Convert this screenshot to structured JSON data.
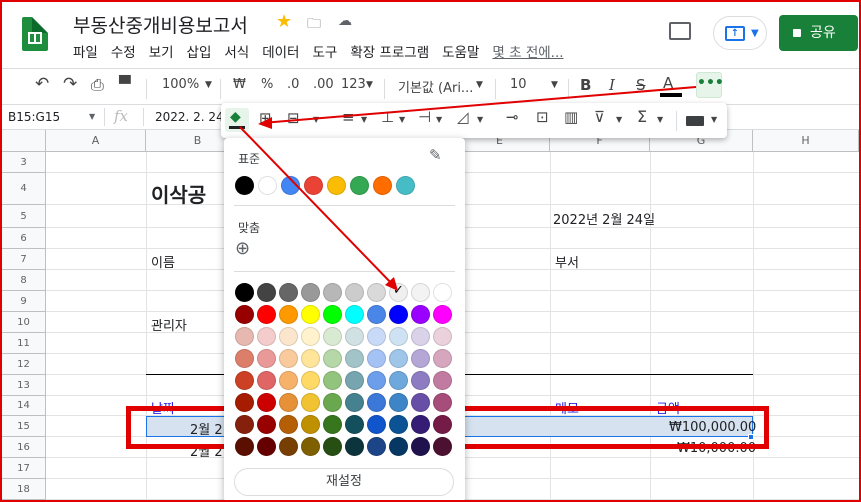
{
  "app": {
    "title": "부동산중개비용보고서",
    "share_label": "공유"
  },
  "menu": [
    "파일",
    "수정",
    "보기",
    "삽입",
    "서식",
    "데이터",
    "도구",
    "확장 프로그램",
    "도움말"
  ],
  "last_edit": "몇 초 전에...",
  "toolbar": {
    "zoom": "100%",
    "currency": "₩",
    "percent": "%",
    "dec_less": ".0",
    "dec_more": ".00",
    "format": "123",
    "font": "기본값 (Ari...",
    "font_size": "10",
    "bold": "B",
    "italic": "I",
    "strike": "S",
    "text_color": "A",
    "more": "•••"
  },
  "formula": {
    "range": "B15:G15",
    "fx": "fx",
    "value": "2022. 2. 24"
  },
  "columns": [
    "A",
    "B",
    "C",
    "D",
    "E",
    "F",
    "G",
    "H"
  ],
  "rows": [
    "3",
    "4",
    "5",
    "6",
    "7",
    "8",
    "9",
    "10",
    "11",
    "12",
    "13",
    "14",
    "15",
    "16",
    "17",
    "18"
  ],
  "cells": {
    "b4": "이삭공",
    "f5": "2022년 2월 24일",
    "b7": "이름",
    "f7": "부서",
    "b10": "관리자",
    "b14": "날짜",
    "f14": "메모",
    "g14": "금액",
    "b15": "2월 2",
    "g15": "₩100,000.00",
    "b16": "2월 2",
    "g16": "₩10,000.00"
  },
  "palette": {
    "standard_label": "표준",
    "custom_label": "맞춤",
    "reset_label": "재설정",
    "standard": [
      "#000000",
      "#ffffff",
      "#4285f4",
      "#ea4335",
      "#fbbc04",
      "#34a853",
      "#ff6d01",
      "#46bdc6"
    ],
    "grid": [
      [
        "#000000",
        "#434343",
        "#666666",
        "#999999",
        "#b7b7b7",
        "#cccccc",
        "#d9d9d9",
        "#efefef",
        "#f3f3f3",
        "#ffffff"
      ],
      [
        "#980000",
        "#ff0000",
        "#ff9900",
        "#ffff00",
        "#00ff00",
        "#00ffff",
        "#4a86e8",
        "#0000ff",
        "#9900ff",
        "#ff00ff"
      ],
      [
        "#e6b8af",
        "#f4cccc",
        "#fce5cd",
        "#fff2cc",
        "#d9ead3",
        "#d0e0e3",
        "#c9daf8",
        "#cfe2f3",
        "#d9d2e9",
        "#ead1dc"
      ],
      [
        "#dd7e6b",
        "#ea9999",
        "#f9cb9c",
        "#ffe599",
        "#b6d7a8",
        "#a2c4c9",
        "#a4c2f4",
        "#9fc5e8",
        "#b4a7d6",
        "#d5a6bd"
      ],
      [
        "#cc4125",
        "#e06666",
        "#f6b26b",
        "#ffd966",
        "#93c47d",
        "#76a5af",
        "#6d9eeb",
        "#6fa8dc",
        "#8e7cc3",
        "#c27ba0"
      ],
      [
        "#a61c00",
        "#cc0000",
        "#e69138",
        "#f1c232",
        "#6aa84f",
        "#45818e",
        "#3c78d8",
        "#3d85c6",
        "#674ea7",
        "#a64d79"
      ],
      [
        "#85200c",
        "#990000",
        "#b45f06",
        "#bf9000",
        "#38761d",
        "#134f5c",
        "#1155cc",
        "#0b5394",
        "#351c75",
        "#741b47"
      ],
      [
        "#5b0f00",
        "#660000",
        "#783f04",
        "#7f6000",
        "#274e13",
        "#0c343d",
        "#1c4587",
        "#073763",
        "#20124d",
        "#4c1130"
      ]
    ],
    "selected_mark": "✓"
  },
  "icons": {
    "undo": "↶",
    "redo": "↷",
    "print": "⎙",
    "fx": "fx",
    "pen": "✎",
    "add": "⊕"
  }
}
